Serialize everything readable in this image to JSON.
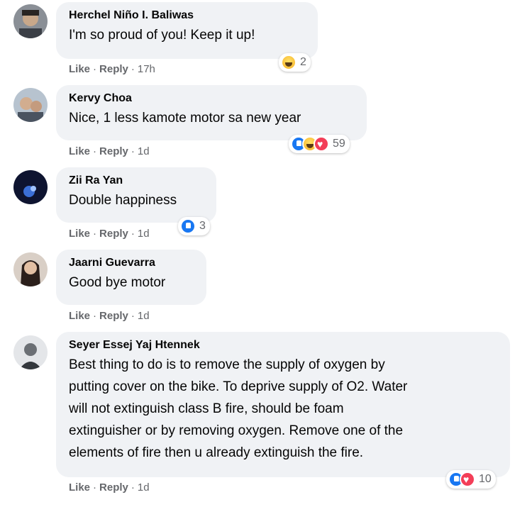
{
  "comments": [
    {
      "author": "Herchel Niño I. Baliwas",
      "text": "I'm so proud of you! Keep it up!",
      "like": "Like",
      "reply": "Reply",
      "time": "17h",
      "reaction_count": "2"
    },
    {
      "author": "Kervy Choa",
      "text": "Nice, 1 less kamote motor sa new year",
      "like": "Like",
      "reply": "Reply",
      "time": "1d",
      "reaction_count": "59"
    },
    {
      "author": "Zii Ra Yan",
      "text": "Double happiness",
      "like": "Like",
      "reply": "Reply",
      "time": "1d",
      "reaction_count": "3"
    },
    {
      "author": "Jaarni Guevarra",
      "text": "Good bye motor",
      "like": "Like",
      "reply": "Reply",
      "time": "1d",
      "reaction_count": ""
    },
    {
      "author": "Seyer Essej Yaj Htennek",
      "text_lines": [
        "Best thing to do is to remove the supply of oxygen by",
        "putting cover on the bike. To deprive supply of O2. Water",
        "will not extinguish class B fire, should be foam",
        "extinguisher or by removing oxygen. Remove one of the",
        "elements of fire then u already extinguish the fire."
      ],
      "like": "Like",
      "reply": "Reply",
      "time": "1d",
      "reaction_count": "10"
    }
  ],
  "separator": "·",
  "colors": {
    "bubble": "#f0f2f5",
    "meta": "#65676b",
    "like_blue": "#1877f2",
    "love_red": "#f33e58",
    "haha_yellow": "#f7b125"
  }
}
